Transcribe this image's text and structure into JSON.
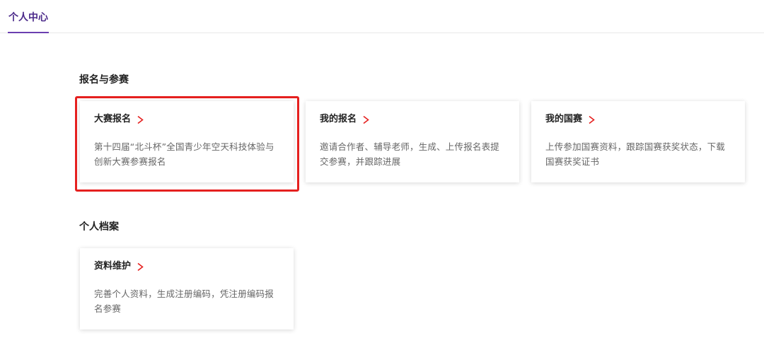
{
  "header": {
    "active_tab": "个人中心",
    "accent_color": "#6b3fb0"
  },
  "sections": [
    {
      "title": "报名与参赛",
      "cards": [
        {
          "title": "大赛报名",
          "description": "第十四届“北斗杯”全国青少年空天科技体验与创新大赛参赛报名",
          "highlighted": true
        },
        {
          "title": "我的报名",
          "description": "邀请合作者、辅导老师，生成、上传报名表提交参赛，并跟踪进展"
        },
        {
          "title": "我的国赛",
          "description": "上传参加国赛资料，跟踪国赛获奖状态，下载国赛获奖证书"
        }
      ]
    },
    {
      "title": "个人档案",
      "cards": [
        {
          "title": "资料维护",
          "description": "完善个人资料，生成注册编码，凭注册编码报名参赛"
        }
      ]
    }
  ],
  "icons": {
    "card_arrow": "chevron-right-icon",
    "arrow_color": "#e5201f",
    "highlight_color": "#e5201f"
  }
}
